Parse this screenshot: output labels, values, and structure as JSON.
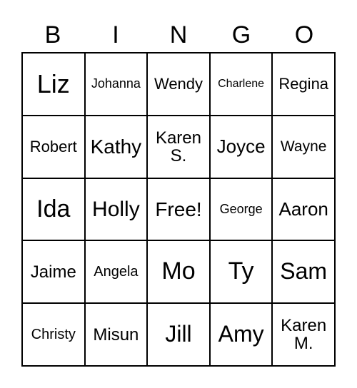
{
  "header": [
    "B",
    "I",
    "N",
    "G",
    "O"
  ],
  "cells": [
    "Liz",
    "Johanna",
    "Wendy",
    "Charlene",
    "Regina",
    "Robert",
    "Kathy",
    "Karen S.",
    "Joyce",
    "Wayne",
    "Ida",
    "Holly",
    "Free!",
    "George",
    "Aaron",
    "Jaime",
    "Angela",
    "Mo",
    "Ty",
    "Sam",
    "Christy",
    "Misun",
    "Jill",
    "Amy",
    "Karen M."
  ]
}
